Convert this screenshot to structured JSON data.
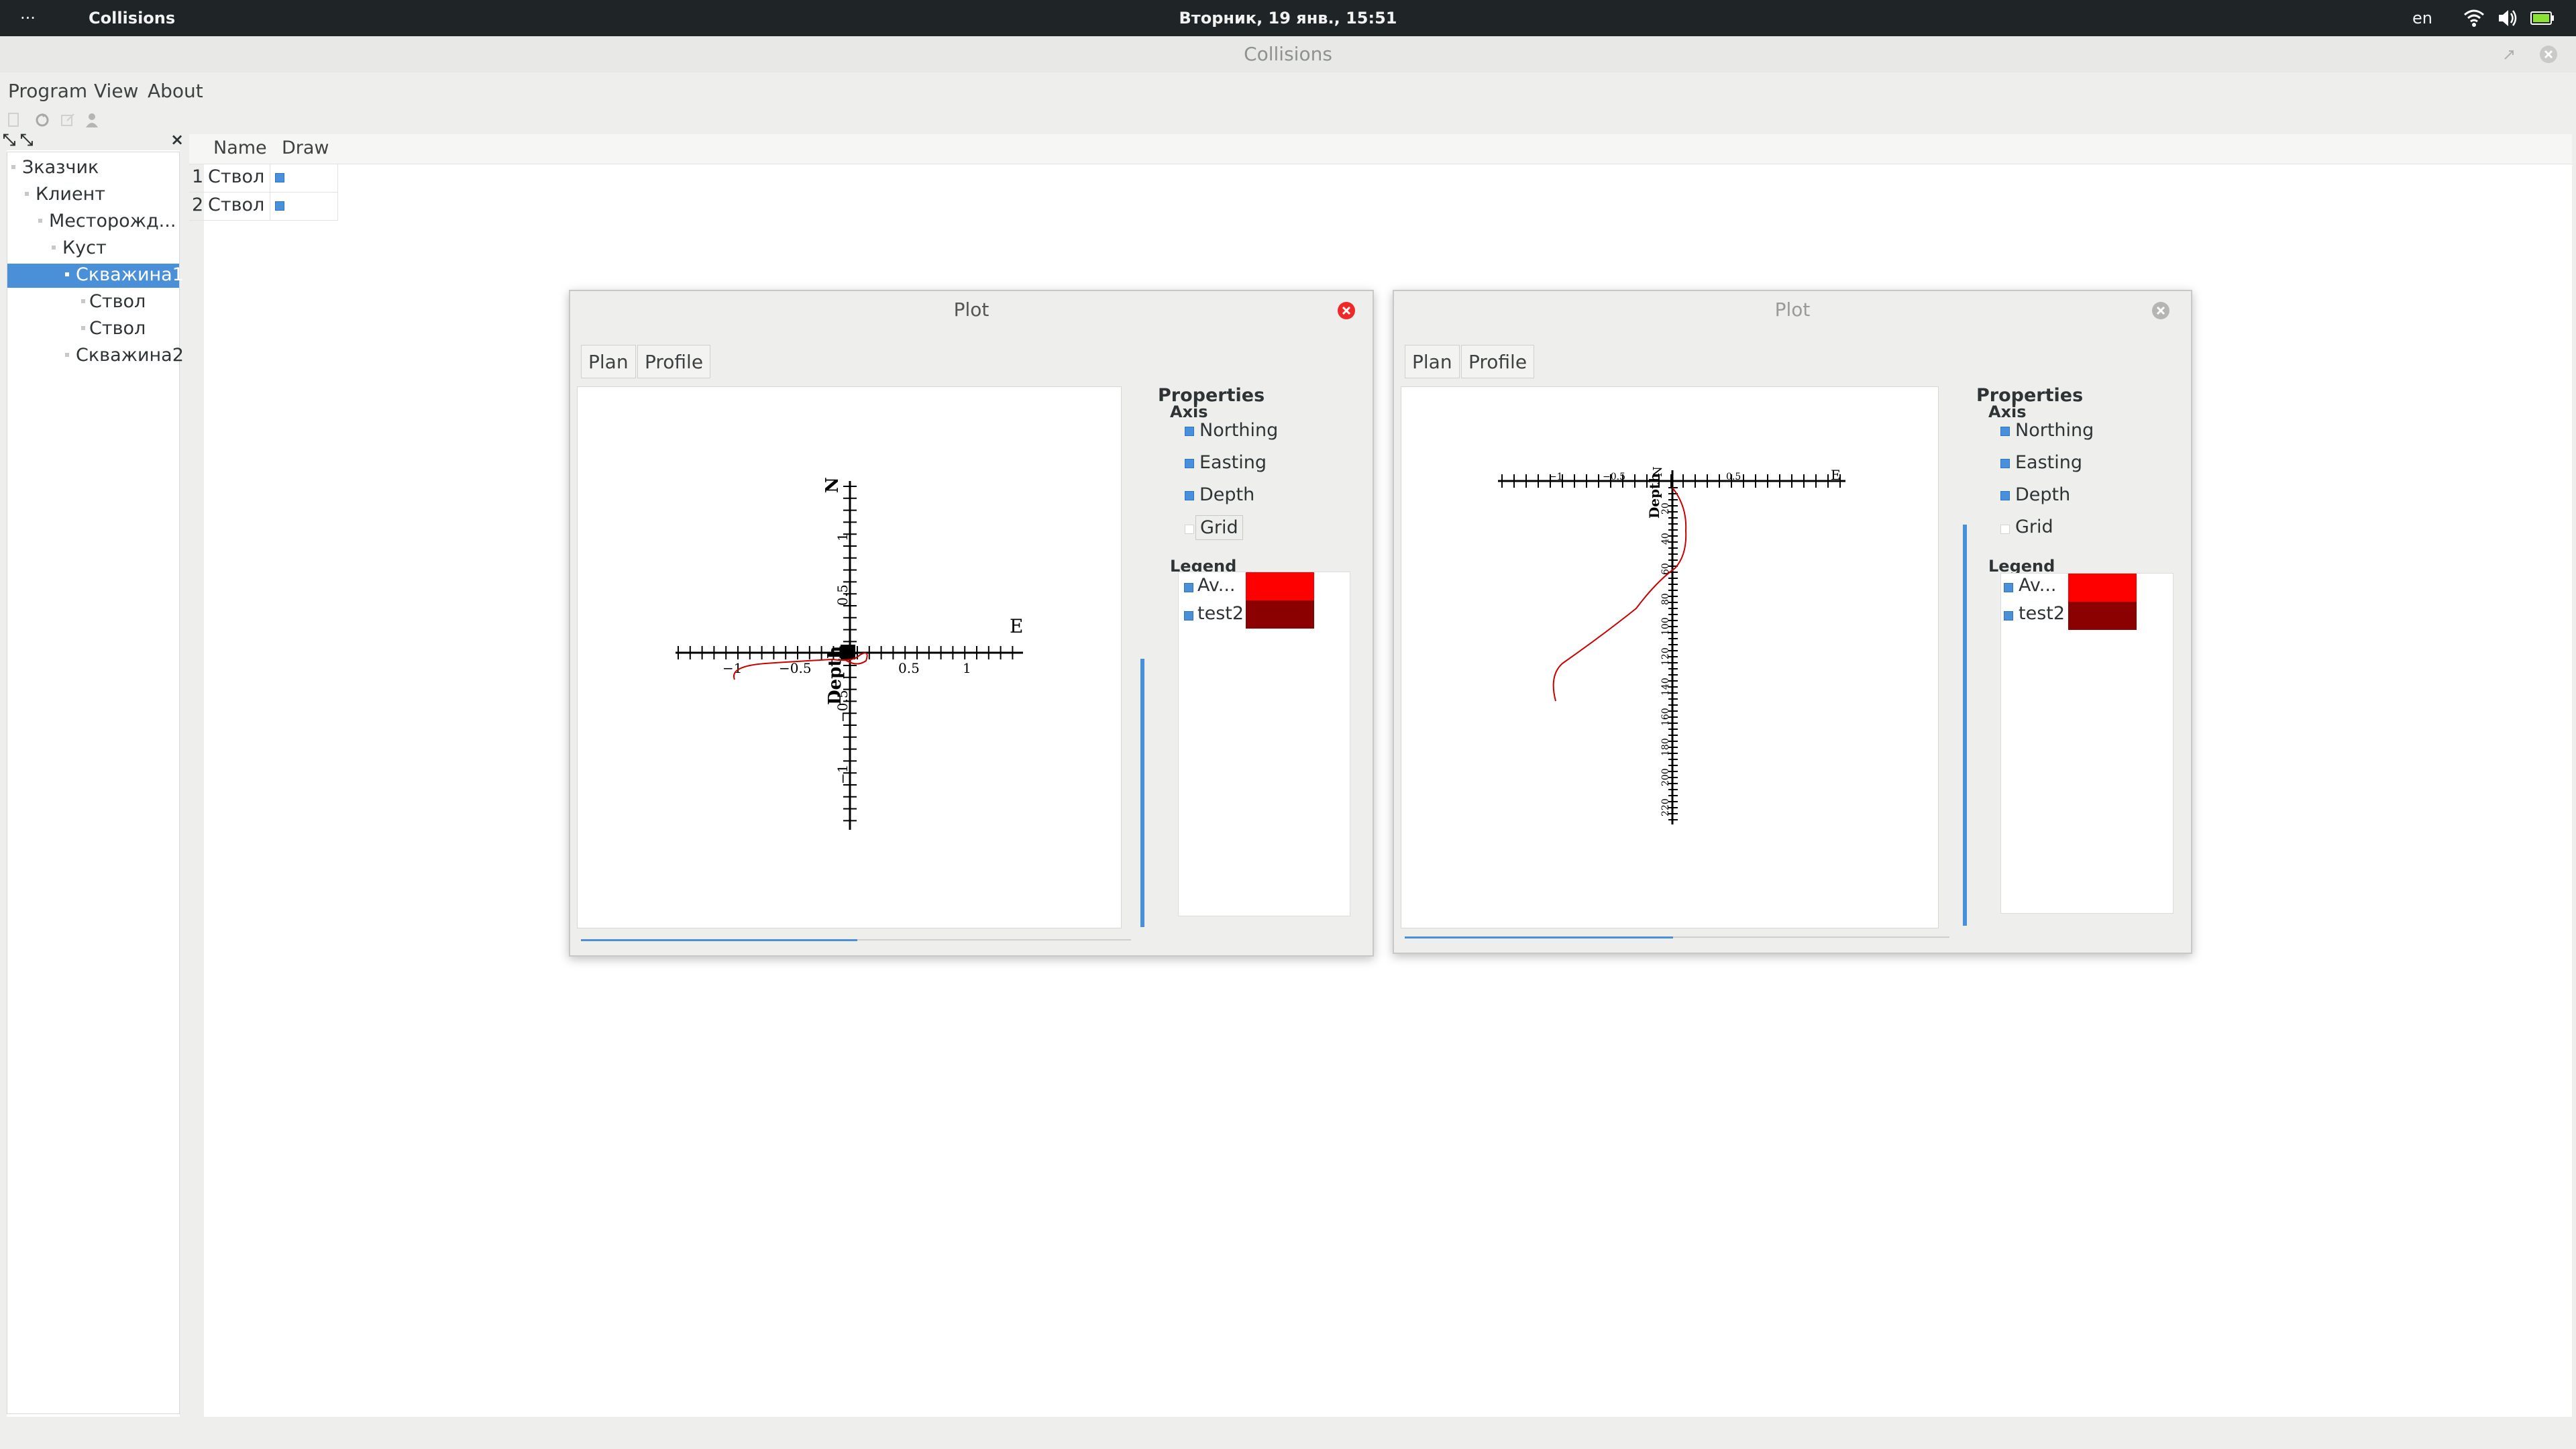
{
  "topbar": {
    "activities": "···",
    "app": "Collisions",
    "clock": "Вторник, 19 янв., 15:51",
    "lang": "en"
  },
  "window": {
    "title": "Collisions",
    "menus": [
      "Program",
      "View",
      "About"
    ]
  },
  "tree": {
    "items": [
      {
        "label": "Зказчик",
        "selected": false
      },
      {
        "label": "Клиент",
        "selected": false
      },
      {
        "label": "Месторожд...",
        "selected": false
      },
      {
        "label": "Куст",
        "selected": false
      },
      {
        "label": "Скважина1",
        "selected": true
      },
      {
        "label": "Ствол",
        "selected": false
      },
      {
        "label": "Ствол",
        "selected": false
      },
      {
        "label": "Скважина2",
        "selected": false
      }
    ]
  },
  "table": {
    "headers": [
      "Name",
      "Draw"
    ],
    "rows": [
      {
        "num": "1",
        "name": "Ствол",
        "draw": true
      },
      {
        "num": "2",
        "name": "Ствол",
        "draw": true
      }
    ]
  },
  "plots": [
    {
      "title": "Plot",
      "active": true,
      "tabs": [
        "Plan",
        "Profile"
      ],
      "properties_label": "Properties",
      "axis_label": "Axis",
      "axis_options": [
        {
          "label": "Northing",
          "checked": true
        },
        {
          "label": "Easting",
          "checked": true
        },
        {
          "label": "Depth",
          "checked": true
        },
        {
          "label": "Grid",
          "checked": false
        }
      ],
      "legend_label": "Legend",
      "legend": [
        {
          "label": "Av...",
          "checked": true,
          "color": "#ff0000"
        },
        {
          "label": "test2",
          "checked": true,
          "color": "#8b0000"
        }
      ],
      "axis_text": {
        "n": "N",
        "e": "E",
        "depth": "Depth"
      },
      "x_ticks": [
        "−1",
        "−0.5",
        "0.5",
        "1"
      ],
      "y_ticks": [
        "1",
        "0.5",
        "−0.5",
        "−1"
      ],
      "trace_color": "#cc0000"
    },
    {
      "title": "Plot",
      "active": false,
      "tabs": [
        "Plan",
        "Profile"
      ],
      "properties_label": "Properties",
      "axis_label": "Axis",
      "axis_options": [
        {
          "label": "Northing",
          "checked": true
        },
        {
          "label": "Easting",
          "checked": true
        },
        {
          "label": "Depth",
          "checked": true
        },
        {
          "label": "Grid",
          "checked": false
        }
      ],
      "legend_label": "Legend",
      "legend": [
        {
          "label": "Av...",
          "checked": true,
          "color": "#ff0000"
        },
        {
          "label": "test2",
          "checked": true,
          "color": "#8b0000"
        }
      ],
      "axis_text": {
        "n": "N",
        "e": "E",
        "depth": "Depth"
      },
      "x_ticks": [
        "−1",
        "−0.5",
        "0.5"
      ],
      "depth_ticks": [
        "20",
        "40",
        "60",
        "80",
        "100",
        "120",
        "140",
        "160",
        "180",
        "200",
        "220"
      ],
      "trace_color": "#cc0000"
    }
  ]
}
